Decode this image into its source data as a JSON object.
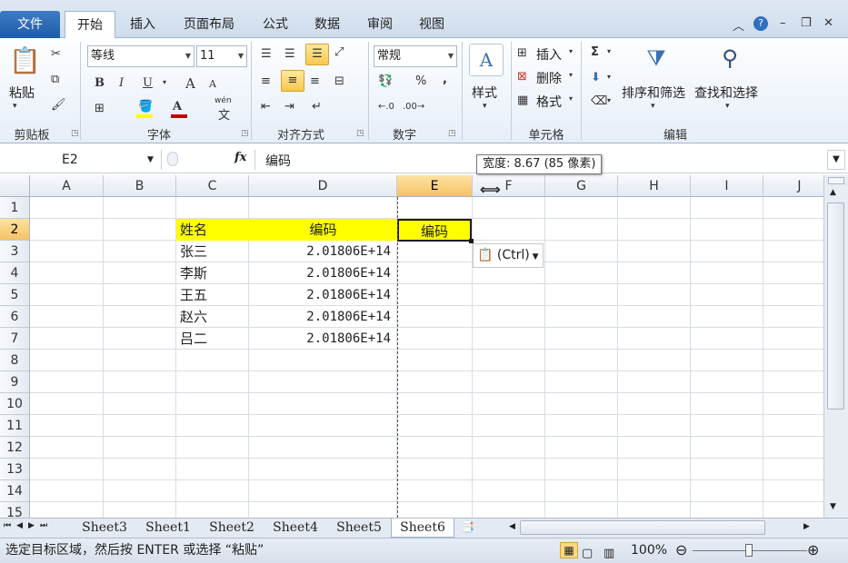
{
  "tabs": {
    "file": "文件",
    "home": "开始",
    "insert": "插入",
    "layout": "页面布局",
    "formulas": "公式",
    "data": "数据",
    "review": "审阅",
    "view": "视图"
  },
  "ribbon": {
    "clipboard": {
      "paste": "粘贴",
      "label": "剪贴板"
    },
    "font": {
      "name": "等线",
      "size": "11",
      "label": "字体",
      "bold": "B",
      "italic": "I",
      "underline": "U",
      "grow": "A",
      "shrink": "A",
      "wen": "wén",
      "fill_color": "#ffff00",
      "font_color": "#c00000"
    },
    "align": {
      "label": "对齐方式"
    },
    "number": {
      "format": "常规",
      "label": "数字",
      "percent": "%",
      "comma": ","
    },
    "styles": {
      "label": "样式"
    },
    "cells": {
      "insert": "插入",
      "delete": "删除",
      "format": "格式",
      "label": "单元格"
    },
    "editing": {
      "sigma": "Σ",
      "sort": "排序和筛选",
      "find": "查找和选择",
      "label": "编辑"
    }
  },
  "formula_bar": {
    "name_box": "E2",
    "fx": "fx",
    "content": "编码"
  },
  "tooltip": "宽度: 8.67 (85 像素)",
  "grid": {
    "columns": [
      "A",
      "B",
      "C",
      "D",
      "E",
      "F",
      "G",
      "H",
      "I",
      "J"
    ],
    "rows": [
      "1",
      "2",
      "3",
      "4",
      "5",
      "6",
      "7",
      "8",
      "9",
      "10",
      "11",
      "12",
      "13",
      "14",
      "15"
    ],
    "selected_col": "E",
    "selected_row": "2",
    "headers": {
      "c": "姓名",
      "d": "编码",
      "e": "编码"
    },
    "data": [
      {
        "name": "张三",
        "code": "2.01806E+14"
      },
      {
        "name": "李斯",
        "code": "2.01806E+14"
      },
      {
        "name": "王五",
        "code": "2.01806E+14"
      },
      {
        "name": "赵六",
        "code": "2.01806E+14"
      },
      {
        "name": "吕二",
        "code": "2.01806E+14"
      }
    ]
  },
  "paste_tag": "(Ctrl)",
  "sheets": [
    "Sheet3",
    "Sheet1",
    "Sheet2",
    "Sheet4",
    "Sheet5",
    "Sheet6"
  ],
  "active_sheet": "Sheet6",
  "status": {
    "message": "选定目标区域，然后按 ENTER 或选择 “粘贴”",
    "zoom": "100%"
  },
  "colors": {
    "accent": "#1f5ca8",
    "highlight": "#ffff00"
  }
}
